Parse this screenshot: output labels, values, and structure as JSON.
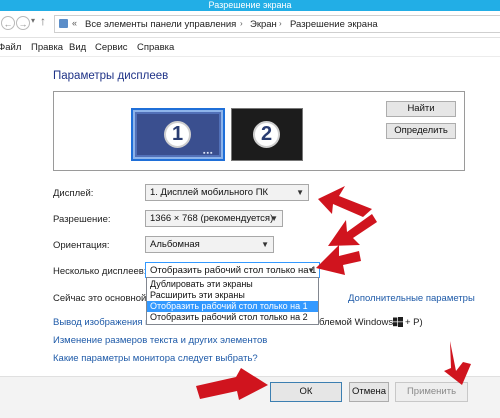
{
  "window": {
    "title": "Разрешение экрана"
  },
  "address": {
    "prefix": "«",
    "crumbs": [
      "Все элементы панели управления",
      "Экран",
      "Разрешение экрана"
    ],
    "separator": "›"
  },
  "menu": [
    "Файл",
    "Правка",
    "Вид",
    "Сервис",
    "Справка"
  ],
  "page_title": "Параметры дисплеев",
  "preview": {
    "monitor1": "1",
    "monitor2": "2",
    "dots": "▪▪▪"
  },
  "buttons": {
    "find": "Найти",
    "detect": "Определить",
    "ok": "ОК",
    "cancel": "Отмена",
    "apply": "Применить"
  },
  "fields": {
    "display": {
      "label": "Дисплей:",
      "value": "1. Дисплей мобильного ПК"
    },
    "resolution": {
      "label": "Разрешение:",
      "value": "1366 × 768 (рекомендуется)"
    },
    "orientation": {
      "label": "Ориентация:",
      "value": "Альбомная"
    },
    "multiple": {
      "label": "Несколько дисплеев:",
      "value": "Отобразить рабочий стол только на 1"
    }
  },
  "dropdown_options": [
    "Дублировать эти экраны",
    "Расширить эти экраны",
    "Отобразить рабочий стол только на 1",
    "Отобразить рабочий стол только на 2"
  ],
  "status_text": "Сейчас это основной ди",
  "links": {
    "advanced": "Дополнительные параметры",
    "projector": "Вывод изображения на",
    "projector_suffix": "блемой Windows",
    "projector_tail": "+ P)",
    "text_size": "Изменение размеров текста и других элементов",
    "which_params": "Какие параметры монитора следует выбрать?"
  },
  "colors": {
    "titlebar": "#22aee6",
    "link": "#1e5aa8",
    "page_title": "#1e3287",
    "selection": "#3399ff",
    "annotation_arrow": "#d0141e"
  },
  "icons": [
    "back-icon",
    "forward-icon",
    "up-icon",
    "control-panel-icon",
    "windows-logo-icon",
    "chevron-down-icon"
  ]
}
